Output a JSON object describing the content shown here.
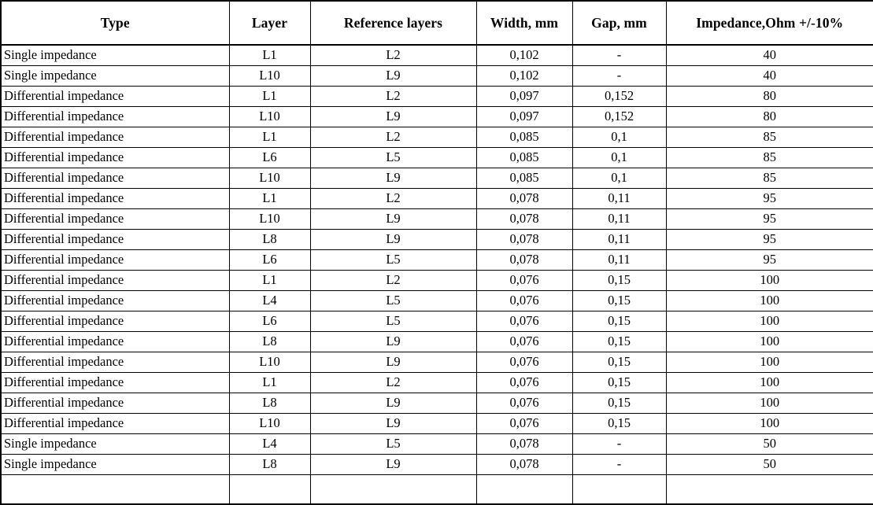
{
  "table": {
    "columns": [
      {
        "key": "type",
        "label": "Type"
      },
      {
        "key": "layer",
        "label": "Layer"
      },
      {
        "key": "ref",
        "label": "Reference layers"
      },
      {
        "key": "width",
        "label": "Width, mm"
      },
      {
        "key": "gap",
        "label": "Gap, mm"
      },
      {
        "key": "imp",
        "label": "Impedance,Ohm +/-10%"
      }
    ],
    "rows": [
      {
        "type": "Single impedance",
        "layer": "L1",
        "ref": "L2",
        "width": "0,102",
        "gap": "-",
        "imp": "40"
      },
      {
        "type": "Single impedance",
        "layer": "L10",
        "ref": "L9",
        "width": "0,102",
        "gap": "-",
        "imp": "40"
      },
      {
        "type": "Differential impedance",
        "layer": "L1",
        "ref": "L2",
        "width": "0,097",
        "gap": "0,152",
        "imp": "80"
      },
      {
        "type": "Differential impedance",
        "layer": "L10",
        "ref": "L9",
        "width": "0,097",
        "gap": "0,152",
        "imp": "80"
      },
      {
        "type": "Differential impedance",
        "layer": "L1",
        "ref": "L2",
        "width": "0,085",
        "gap": "0,1",
        "imp": "85"
      },
      {
        "type": "Differential impedance",
        "layer": "L6",
        "ref": "L5",
        "width": "0,085",
        "gap": "0,1",
        "imp": "85"
      },
      {
        "type": "Differential impedance",
        "layer": "L10",
        "ref": "L9",
        "width": "0,085",
        "gap": "0,1",
        "imp": "85"
      },
      {
        "type": "Differential impedance",
        "layer": "L1",
        "ref": "L2",
        "width": "0,078",
        "gap": "0,11",
        "imp": "95"
      },
      {
        "type": "Differential impedance",
        "layer": "L10",
        "ref": "L9",
        "width": "0,078",
        "gap": "0,11",
        "imp": "95"
      },
      {
        "type": "Differential impedance",
        "layer": "L8",
        "ref": "L9",
        "width": "0,078",
        "gap": "0,11",
        "imp": "95"
      },
      {
        "type": "Differential impedance",
        "layer": "L6",
        "ref": "L5",
        "width": "0,078",
        "gap": "0,11",
        "imp": "95"
      },
      {
        "type": "Differential impedance",
        "layer": "L1",
        "ref": "L2",
        "width": "0,076",
        "gap": "0,15",
        "imp": "100"
      },
      {
        "type": "Differential impedance",
        "layer": "L4",
        "ref": "L5",
        "width": "0,076",
        "gap": "0,15",
        "imp": "100"
      },
      {
        "type": "Differential impedance",
        "layer": "L6",
        "ref": "L5",
        "width": "0,076",
        "gap": "0,15",
        "imp": "100"
      },
      {
        "type": "Differential impedance",
        "layer": "L8",
        "ref": "L9",
        "width": "0,076",
        "gap": "0,15",
        "imp": "100"
      },
      {
        "type": "Differential impedance",
        "layer": "L10",
        "ref": "L9",
        "width": "0,076",
        "gap": "0,15",
        "imp": "100"
      },
      {
        "type": "Differential impedance",
        "layer": "L1",
        "ref": "L2",
        "width": "0,076",
        "gap": "0,15",
        "imp": "100"
      },
      {
        "type": "Differential impedance",
        "layer": "L8",
        "ref": "L9",
        "width": "0,076",
        "gap": "0,15",
        "imp": "100"
      },
      {
        "type": "Differential impedance",
        "layer": "L10",
        "ref": "L9",
        "width": "0,076",
        "gap": "0,15",
        "imp": "100"
      },
      {
        "type": "Single impedance",
        "layer": "L4",
        "ref": "L5",
        "width": "0,078",
        "gap": "-",
        "imp": "50"
      },
      {
        "type": "Single impedance",
        "layer": "L8",
        "ref": "L9",
        "width": "0,078",
        "gap": "-",
        "imp": "50"
      },
      {
        "type": "",
        "layer": "",
        "ref": "",
        "width": "",
        "gap": "",
        "imp": ""
      }
    ]
  },
  "style": {
    "border_color": "#000000",
    "text_color": "#000000",
    "background": "#ffffff"
  }
}
